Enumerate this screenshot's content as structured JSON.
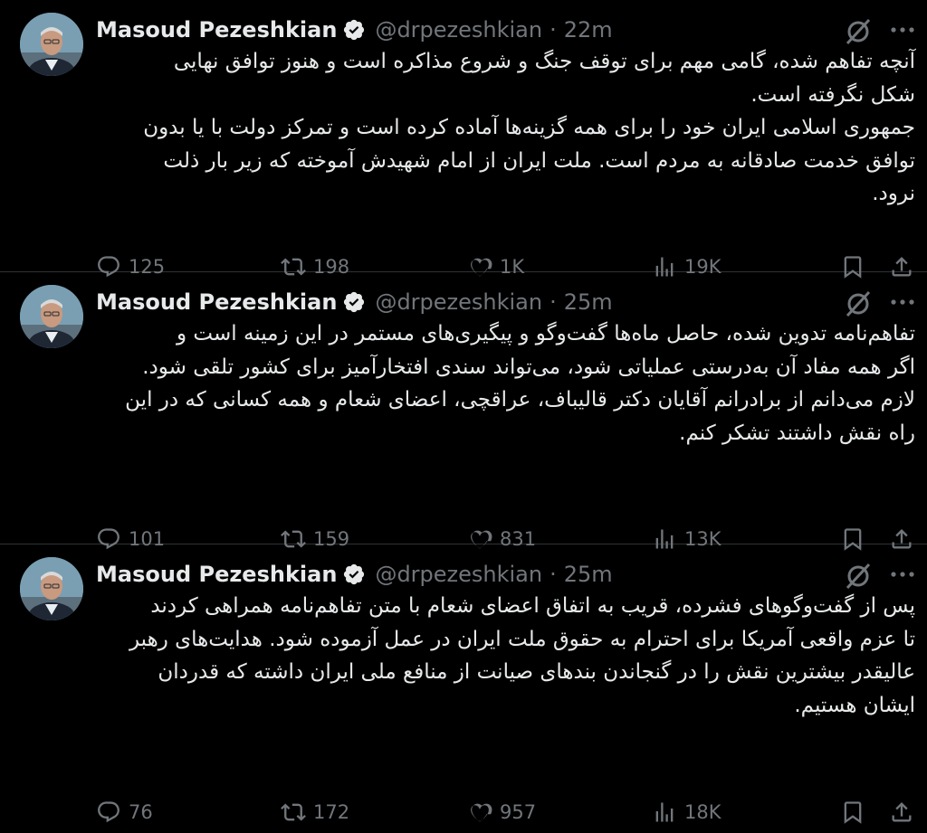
{
  "tweets": [
    {
      "author": "Masoud Pezeshkian",
      "handle": "@drpezeshkian",
      "separator": "·",
      "time": "22m",
      "text_lines": [
        "آنچه تفاهم شده، گامی مهم برای توقف جنگ و شروع مذاکره است و هنوز توافق نهایی",
        "شکل نگرفته است.",
        "جمهوری اسلامی ایران خود را برای همه گزینه‌ها آماده کرده است و تمرکز دولت با یا بدون",
        "توافق خدمت صادقانه به مردم است. ملت ایران از امام شهیدش آموخته که زیر بار ذلت",
        "نرود."
      ],
      "replies": "125",
      "reposts": "198",
      "likes": "1K",
      "views": "19K"
    },
    {
      "author": "Masoud Pezeshkian",
      "handle": "@drpezeshkian",
      "separator": "·",
      "time": "25m",
      "text_lines": [
        "تفاهم‌نامه تدوین شده، حاصل ماه‌ها گفت‌وگو و پیگیری‌های مستمر در این زمینه است و",
        "اگر همه مفاد آن به‌درستی عملیاتی شود، می‌تواند سندی افتخارآمیز برای کشور تلقی شود.",
        "لازم می‌دانم از برادرانم آقایان دکتر قالیباف، عراقچی، اعضای شعام و همه کسانی که در این",
        "راه نقش داشتند تشکر کنم."
      ],
      "replies": "101",
      "reposts": "159",
      "likes": "831",
      "views": "13K"
    },
    {
      "author": "Masoud Pezeshkian",
      "handle": "@drpezeshkian",
      "separator": "·",
      "time": "25m",
      "text_lines": [
        "پس از گفت‌وگوهای فشرده، قریب به اتفاق اعضای شعام با متن تفاهم‌نامه همراهی کردند",
        "تا عزم واقعی آمریکا برای احترام به حقوق ملت ایران در عمل آزموده شود. هدایت‌های رهبر",
        "عالیقدر بیشترین نقش را در گنجاندن بندهای صیانت از منافع ملی ایران داشته که قدردان",
        "ایشان هستیم."
      ],
      "replies": "76",
      "reposts": "172",
      "likes": "957",
      "views": "18K"
    }
  ],
  "icons": {
    "avatar": "avatar-photo",
    "verified": "verified-badge-icon",
    "grok": "grok-icon",
    "more": "more-icon",
    "reply": "reply-icon",
    "repost": "repost-icon",
    "like": "heart-icon",
    "views": "views-icon",
    "bookmark": "bookmark-icon",
    "share": "share-icon"
  },
  "colors": {
    "background": "#000000",
    "text": "#e7e9ea",
    "muted": "#71767b",
    "divider": "#2f3336"
  }
}
